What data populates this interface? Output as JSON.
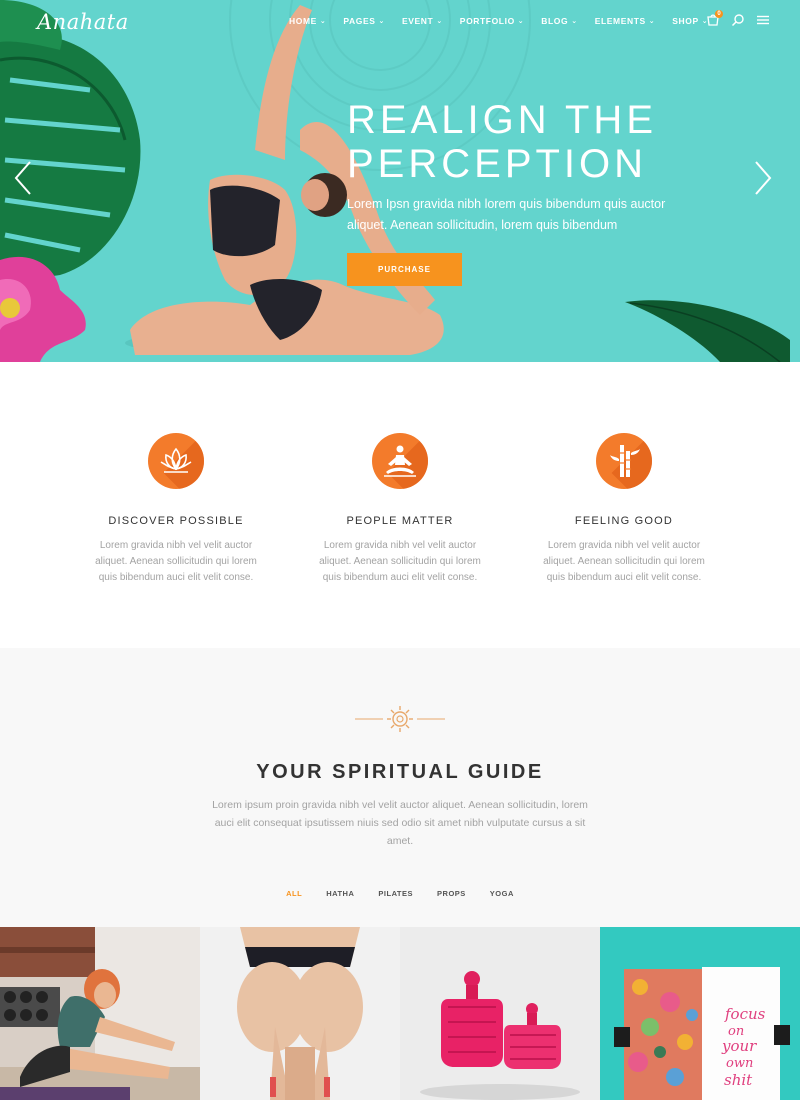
{
  "brand": {
    "logo": "Anahata"
  },
  "nav": {
    "items": [
      {
        "label": "HOME",
        "active": true
      },
      {
        "label": "PAGES"
      },
      {
        "label": "EVENT"
      },
      {
        "label": "PORTFOLIO"
      },
      {
        "label": "BLOG"
      },
      {
        "label": "ELEMENTS"
      },
      {
        "label": "SHOP"
      }
    ],
    "cart_count": "0",
    "icons": [
      "cart-icon",
      "search-icon",
      "hamburger-menu-icon"
    ]
  },
  "hero": {
    "title_line1": "REALIGN THE",
    "title_line2": "PERCEPTION",
    "subtitle": "Lorem Ipsn gravida nibh lorem quis bibendum quis auctor aliquet. Aenean sollicitudin, lorem quis bibendum",
    "button_label": "PURCHASE",
    "bg_color": "#63d4cd",
    "accent_color": "#f7931e"
  },
  "features": [
    {
      "icon": "lotus-icon",
      "title": "DISCOVER POSSIBLE",
      "text": "Lorem gravida nibh vel velit auctor aliquet. Aenean sollicitudin qui lorem quis bibendum auci elit velit conse."
    },
    {
      "icon": "meditation-icon",
      "title": "PEOPLE MATTER",
      "text": "Lorem gravida nibh vel velit auctor aliquet. Aenean sollicitudin qui lorem quis bibendum auci elit velit conse."
    },
    {
      "icon": "bamboo-icon",
      "title": "FEELING GOOD",
      "text": "Lorem gravida nibh vel velit auctor aliquet. Aenean sollicitudin qui lorem quis bibendum auci elit velit conse."
    }
  ],
  "guide": {
    "title": "YOUR SPIRITUAL GUIDE",
    "description": "Lorem ipsum proin gravida nibh vel velit auctor aliquet. Aenean sollicitudin, lorem auci elit consequat ipsutissem niuis sed odio sit amet nibh vulputate cursus a sit amet.",
    "filters": [
      {
        "label": "ALL",
        "active": true
      },
      {
        "label": "HATHA"
      },
      {
        "label": "PILATES"
      },
      {
        "label": "PROPS"
      },
      {
        "label": "YOGA"
      }
    ]
  },
  "gallery": {
    "notebook_text": [
      "focus",
      "on",
      "your",
      "own",
      "shit"
    ]
  }
}
